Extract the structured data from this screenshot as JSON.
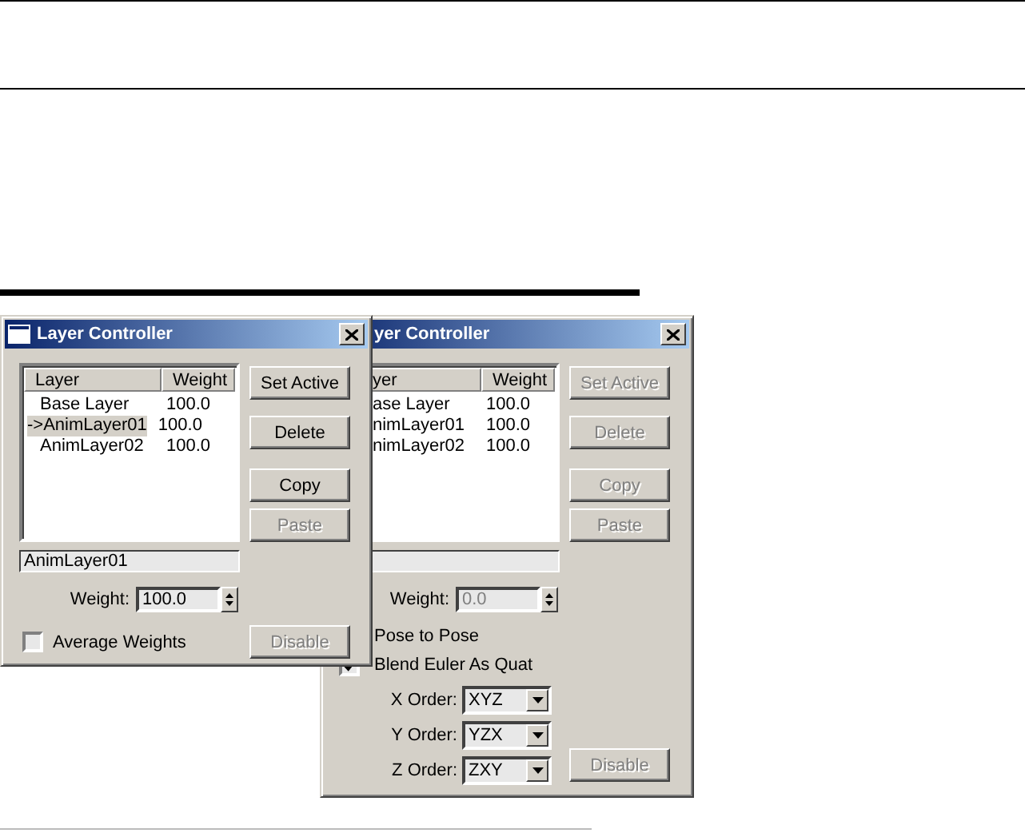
{
  "windows": [
    {
      "title": "Layer Controller",
      "columns": [
        "Layer",
        "Weight"
      ],
      "rows": [
        {
          "layer": "Base Layer",
          "weight": "100.0",
          "selected": false
        },
        {
          "layer": "->AnimLayer01",
          "weight": "100.0",
          "selected": true
        },
        {
          "layer": "AnimLayer02",
          "weight": "100.0",
          "selected": false
        }
      ],
      "buttons": [
        {
          "label": "Set Active",
          "disabled": false
        },
        {
          "label": "Delete",
          "disabled": false
        },
        {
          "label": "Copy",
          "disabled": false
        },
        {
          "label": "Paste",
          "disabled": true
        }
      ],
      "name_value": "AnimLayer01",
      "weight": {
        "label": "Weight:",
        "value": "100.0",
        "disabled": false
      },
      "options": [
        {
          "kind": "checkbox",
          "label": "Average Weights",
          "checked": false
        }
      ],
      "disable_button": {
        "label": "Disable",
        "disabled": true
      }
    },
    {
      "title": "yer Controller",
      "columns": [
        "yer",
        "Weight"
      ],
      "rows": [
        {
          "layer": "ase Layer",
          "weight": "100.0",
          "selected": false
        },
        {
          "layer": "nimLayer01",
          "weight": "100.0",
          "selected": false
        },
        {
          "layer": "nimLayer02",
          "weight": "100.0",
          "selected": false
        }
      ],
      "buttons": [
        {
          "label": "Set Active",
          "disabled": true
        },
        {
          "label": "Delete",
          "disabled": true
        },
        {
          "label": "Copy",
          "disabled": true
        },
        {
          "label": "Paste",
          "disabled": true
        }
      ],
      "weight": {
        "label": "Weight:",
        "value": "0.0",
        "disabled": true
      },
      "options": [
        {
          "kind": "text",
          "label": "Pose to Pose"
        },
        {
          "kind": "checkbox",
          "label": "Blend Euler As Quat",
          "checked": true
        }
      ],
      "orders": [
        {
          "label": "X Order:",
          "value": "XYZ"
        },
        {
          "label": "Y Order:",
          "value": "YZX"
        },
        {
          "label": "Z Order:",
          "value": "ZXY"
        }
      ],
      "disable_button": {
        "label": "Disable",
        "disabled": true
      }
    }
  ]
}
